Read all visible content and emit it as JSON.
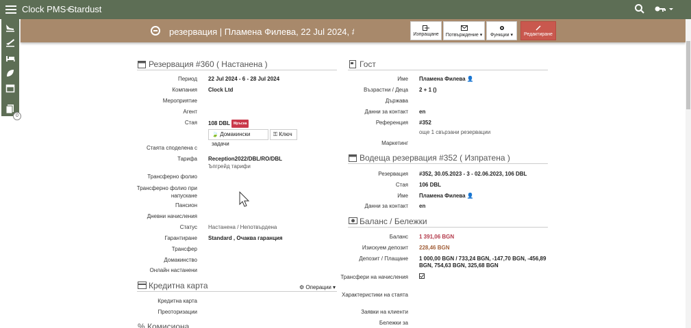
{
  "app": {
    "title": "Clock PMS+",
    "hotel": "Stardust"
  },
  "header": {
    "title": "резервация | Пламена Филева, 22 Jul 2024, #:",
    "buttons": {
      "checkout": "Изпращане",
      "confirmation": "Потвърждение",
      "functions": "Функции",
      "edit": "Редактиране"
    }
  },
  "reservation": {
    "title": "Резервация #360 ( Настанена )",
    "rows": {
      "period": {
        "label": "Период",
        "value": "22 Jul 2024 - 6 - 28 Jul 2024"
      },
      "company": {
        "label": "Компания",
        "value": "Clock Ltd"
      },
      "event": {
        "label": "Мероприятие",
        "value": ""
      },
      "agent": {
        "label": "Агент",
        "value": ""
      },
      "room": {
        "label": "Стая",
        "value": "108 DBL",
        "badge": "Мръсна"
      },
      "room_buttons": {
        "housekeeping": "Домакински задачи",
        "key": "Ключ"
      },
      "shared_room": {
        "label": "Стаята споделена с",
        "value": ""
      },
      "rate": {
        "label": "Тарифа",
        "value": "Reception2022/DBL/RO/DBL",
        "note": "Ъпгрейд тарифи"
      },
      "transfer_folio": {
        "label": "Трансферно фолио",
        "value": ""
      },
      "transfer_folio_checkout": {
        "label": "Трансферно фолио при напускане",
        "value": ""
      },
      "board": {
        "label": "Пансион",
        "value": ""
      },
      "daily_charges": {
        "label": "Дневни начисления",
        "value": ""
      },
      "status": {
        "label": "Статус",
        "value": "Настанена / Непотвърдена"
      },
      "guarantee": {
        "label": "Гаранти­ране",
        "value": "Standard , Очаква гаранция"
      },
      "transfer": {
        "label": "Трансфер",
        "value": ""
      },
      "housekeeping": {
        "label": "Домакинство",
        "value": ""
      },
      "online_checkin": {
        "label": "Онлайн настанени",
        "value": ""
      }
    }
  },
  "credit_card": {
    "title": "Кредитна карта",
    "operations": "Операции",
    "rows": {
      "card": "Кредитна карта",
      "preauth": "Преоторизации"
    }
  },
  "commission": {
    "title": "% Комисиона"
  },
  "guest": {
    "title": "Гост",
    "rows": {
      "name": {
        "label": "Име",
        "value": "Пламена Филева"
      },
      "adults_children": {
        "label": "Възрастни / Деца",
        "value": "2 + 1 ()"
      },
      "country": {
        "label": "Държава",
        "value": ""
      },
      "contact": {
        "label": "Данни за контакт",
        "value": "en"
      },
      "reference": {
        "label": "Референция",
        "value": "#352",
        "note": "още 1 свързани резервации"
      },
      "marketing": {
        "label": "Маркетинг",
        "value": ""
      }
    }
  },
  "lead": {
    "title": "Водеща резервация #352 ( Изпратена )",
    "rows": {
      "reservation": {
        "label": "Резервация",
        "value": "#352, 30.05.2023 - 3 - 02.06.2023, 106 DBL"
      },
      "room": {
        "label": "Стая",
        "value": "106 DBL"
      },
      "name": {
        "label": "Име",
        "value": "Пламена Филева"
      },
      "contact": {
        "label": "Данни за контакт",
        "value": "en"
      }
    }
  },
  "balance": {
    "title": "Баланс / Бележки",
    "rows": {
      "balance": {
        "label": "Баланс",
        "value": "1 391,06 BGN"
      },
      "required_deposit": {
        "label": "Изискуем депозит",
        "value": "228,46 BGN"
      },
      "deposit_payment": {
        "label": "Депозит / Плащане",
        "line1": "1 000,00 BGN / 733,24 BGN, -147,70 BGN, -456,89",
        "line2": "BGN, 754,63 BGN, 325,68 BGN"
      },
      "transfer_charges": {
        "label": "Трансфери на начисления"
      },
      "room_features": {
        "label": "Характеристики на стаята"
      },
      "client_requests": {
        "label": "Заявки на клиенти"
      },
      "notes": {
        "label": "Бележки за"
      }
    }
  },
  "icons": {
    "menu": "menu-icon",
    "search": "search-icon",
    "key": "key-icon",
    "back": "back-arrow-icon"
  },
  "colors": {
    "topbar": "#5d6e55",
    "header": "#a8896b",
    "edit": "#c9584e",
    "badge": "#c9394a"
  }
}
